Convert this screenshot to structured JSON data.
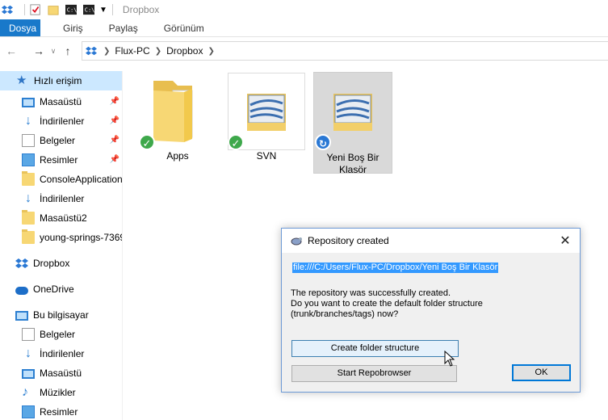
{
  "window": {
    "title": "Dropbox"
  },
  "ribbon": {
    "tabs": [
      "Dosya",
      "Giriş",
      "Paylaş",
      "Görünüm"
    ]
  },
  "address": {
    "crumbs": [
      "Flux-PC",
      "Dropbox"
    ]
  },
  "sidebar": {
    "quick_access": "Hızlı erişim",
    "items": [
      {
        "label": "Masaüstü",
        "icon": "monitor-icon",
        "pinned": true
      },
      {
        "label": "İndirilenler",
        "icon": "download-icon",
        "pinned": true
      },
      {
        "label": "Belgeler",
        "icon": "document-icon",
        "pinned": true
      },
      {
        "label": "Resimler",
        "icon": "pictures-icon",
        "pinned": true
      },
      {
        "label": "ConsoleApplication",
        "icon": "folder-icon",
        "pinned": false
      },
      {
        "label": "İndirilenler",
        "icon": "download-icon",
        "pinned": false
      },
      {
        "label": "Masaüstü2",
        "icon": "folder-icon",
        "pinned": false
      },
      {
        "label": "young-springs-7369",
        "icon": "folder-icon",
        "pinned": false
      }
    ],
    "dropbox": "Dropbox",
    "onedrive": "OneDrive",
    "this_pc": "Bu bilgisayar",
    "pc_items": [
      "Belgeler",
      "İndirilenler",
      "Masaüstü",
      "Müzikler",
      "Resimler"
    ]
  },
  "files": [
    {
      "label": "Apps",
      "status": "synced"
    },
    {
      "label": "SVN",
      "status": "synced"
    },
    {
      "label": "Yeni Boş Bir Klasör",
      "status": "syncing"
    }
  ],
  "dialog": {
    "title": "Repository created",
    "url": "file:///C:/Users/Flux-PC/Dropbox/Yeni Boş Bir Klasör",
    "message": "The repository was successfully created.\nDo you want to create the default folder structure\n(trunk/branches/tags) now?",
    "buttons": {
      "create": "Create folder structure",
      "repobrowser": "Start Repobrowser",
      "ok": "OK"
    }
  },
  "colors": {
    "accent": "#1979ca",
    "selection": "#cce8ff",
    "url_highlight": "#3399ff"
  }
}
